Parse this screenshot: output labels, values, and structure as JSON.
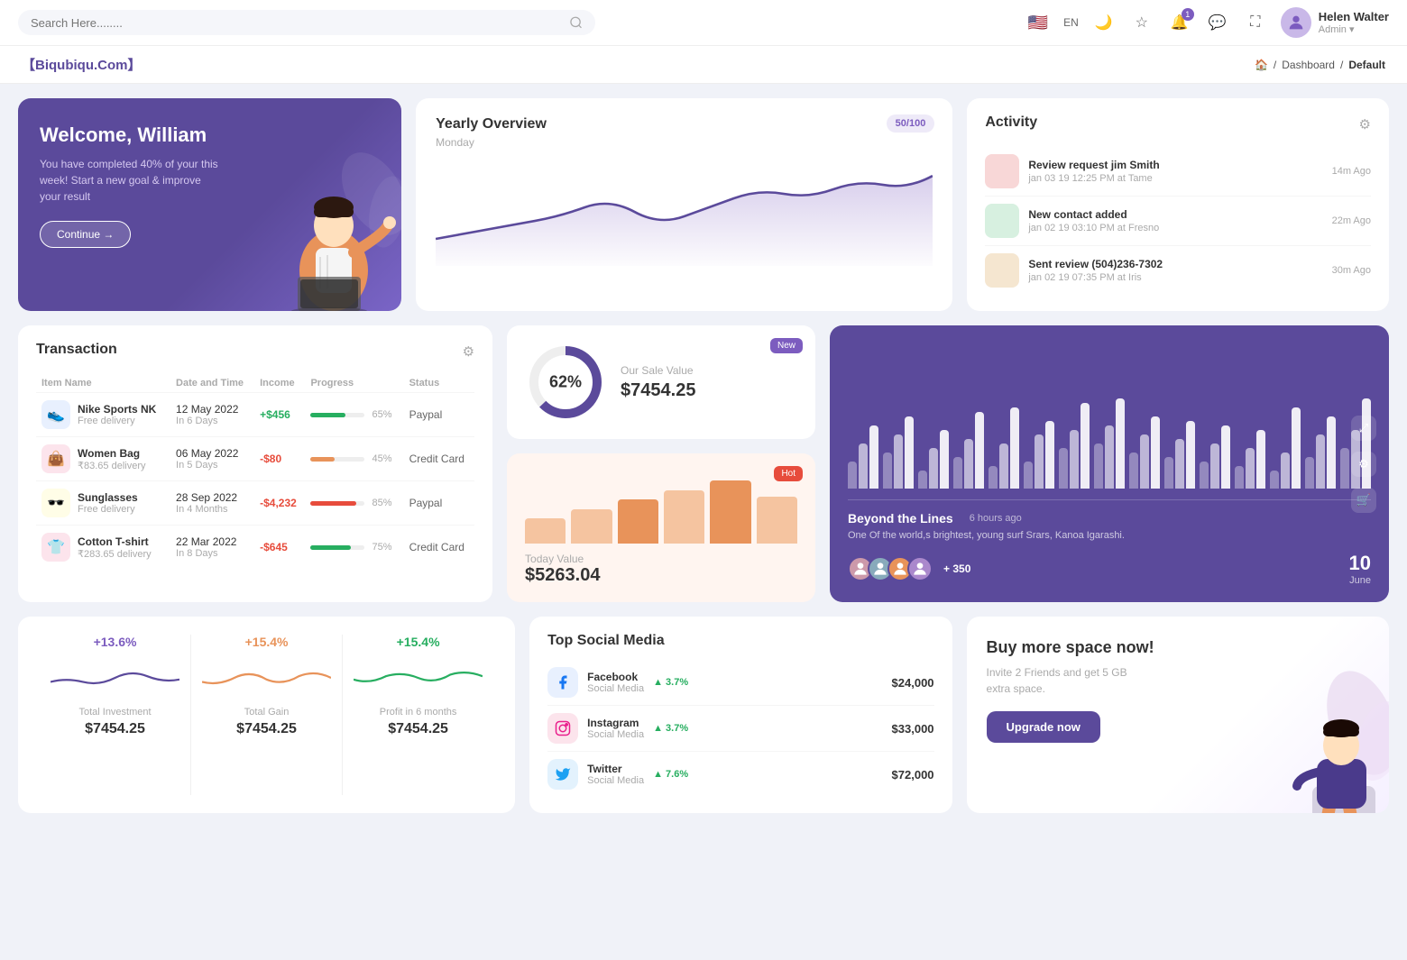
{
  "topnav": {
    "search_placeholder": "Search Here........",
    "lang": "EN",
    "notifications_count": "1",
    "user": {
      "name": "Helen Walter",
      "role": "Admin"
    }
  },
  "breadcrumb": {
    "brand": "【Biqubiqu.Com】",
    "home": "🏠",
    "dashboard": "Dashboard",
    "current": "Default"
  },
  "welcome": {
    "heading": "Welcome, William",
    "body": "You have completed 40% of your this week! Start a new goal & improve your result",
    "button": "Continue →"
  },
  "yearly": {
    "title": "Yearly Overview",
    "sub": "Monday",
    "score": "50/100"
  },
  "activity": {
    "title": "Activity",
    "items": [
      {
        "title": "Review request jim Smith",
        "sub": "jan 03 19 12:25 PM at Tame",
        "time": "14m Ago",
        "color": "pink"
      },
      {
        "title": "New contact added",
        "sub": "jan 02 19 03:10 PM at Fresno",
        "time": "22m Ago",
        "color": "green"
      },
      {
        "title": "Sent review (504)236-7302",
        "sub": "jan 02 19 07:35 PM at Iris",
        "time": "30m Ago",
        "color": "orange"
      }
    ]
  },
  "transaction": {
    "title": "Transaction",
    "columns": [
      "Item Name",
      "Date and Time",
      "Income",
      "Progress",
      "Status"
    ],
    "rows": [
      {
        "icon": "👟",
        "icon_bg": "#e8f0fe",
        "name": "Nike Sports NK",
        "sub": "Free delivery",
        "date": "12 May 2022",
        "days": "In 6 Days",
        "income": "+$456",
        "income_pos": true,
        "progress": 65,
        "progress_color": "#27ae60",
        "status": "Paypal"
      },
      {
        "icon": "👜",
        "icon_bg": "#fce4ec",
        "name": "Women Bag",
        "sub": "₹83.65 delivery",
        "date": "06 May 2022",
        "days": "In 5 Days",
        "income": "-$80",
        "income_pos": false,
        "progress": 45,
        "progress_color": "#e8935a",
        "status": "Credit Card"
      },
      {
        "icon": "🕶️",
        "icon_bg": "#fffde7",
        "name": "Sunglasses",
        "sub": "Free delivery",
        "date": "28 Sep 2022",
        "days": "In 4 Months",
        "income": "-$4,232",
        "income_pos": false,
        "progress": 85,
        "progress_color": "#e74c3c",
        "status": "Paypal"
      },
      {
        "icon": "👕",
        "icon_bg": "#fce4ec",
        "name": "Cotton T-shirt",
        "sub": "₹283.65 delivery",
        "date": "22 Mar 2022",
        "days": "In 8 Days",
        "income": "-$645",
        "income_pos": false,
        "progress": 75,
        "progress_color": "#27ae60",
        "status": "Credit Card"
      }
    ]
  },
  "sale": {
    "new_badge": "New",
    "percent": "62%",
    "title": "Our Sale Value",
    "value": "$7454.25"
  },
  "today": {
    "hot_badge": "Hot",
    "title": "Today Value",
    "value": "$5263.04"
  },
  "barchart": {
    "title": "Beyond the Lines",
    "time_ago": "6 hours ago",
    "description": "One Of the world,s brightest, young surf Srars, Kanoa Igarashi.",
    "plus_count": "+ 350",
    "date_num": "10",
    "date_month": "June"
  },
  "stats": [
    {
      "pct": "+13.6%",
      "color": "pos",
      "label": "Total Investment",
      "value": "$7454.25"
    },
    {
      "pct": "+15.4%",
      "color": "orange",
      "label": "Total Gain",
      "value": "$7454.25"
    },
    {
      "pct": "+15.4%",
      "color": "green",
      "label": "Profit in 6 months",
      "value": "$7454.25"
    }
  ],
  "social": {
    "title": "Top Social Media",
    "items": [
      {
        "platform": "Facebook",
        "type": "Social Media",
        "growth": "3.7%",
        "amount": "$24,000",
        "icon": "f",
        "icon_class": "fb-icon"
      },
      {
        "platform": "Instagram",
        "type": "Social Media",
        "growth": "3.7%",
        "amount": "$33,000",
        "icon": "📷",
        "icon_class": "ig-icon"
      },
      {
        "platform": "Twitter",
        "type": "Social Media",
        "growth": "7.6%",
        "amount": "$72,000",
        "icon": "🐦",
        "icon_class": "tw-icon"
      }
    ]
  },
  "buy_space": {
    "title": "Buy more space now!",
    "body": "Invite 2 Friends and get 5 GB extra space.",
    "button": "Upgrade now"
  }
}
